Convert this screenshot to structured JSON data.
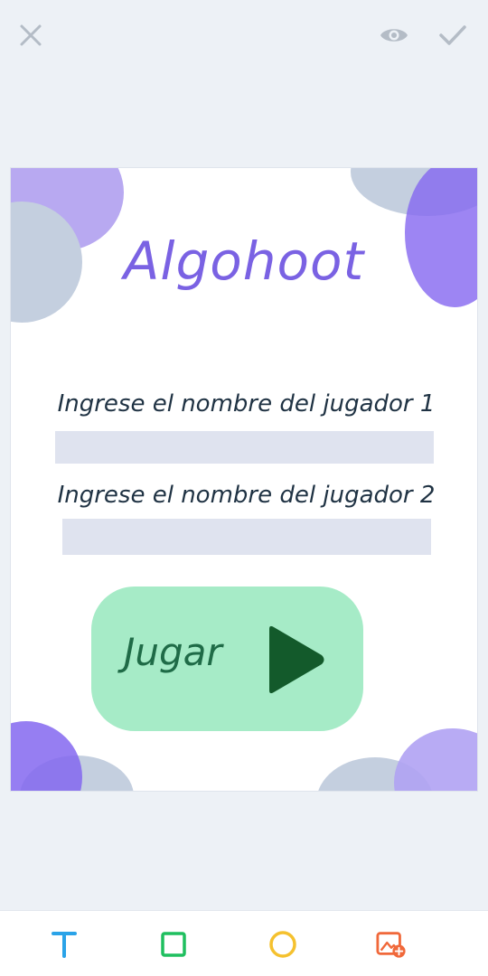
{
  "toolbar_top": {
    "close_icon": "close-icon",
    "preview_icon": "eye-icon",
    "confirm_icon": "check-icon"
  },
  "design": {
    "title": "Algohoot",
    "player1_prompt": "Ingrese el nombre del jugador 1",
    "player1_value": "",
    "player2_prompt": "Ingrese el nombre del jugador 2",
    "player2_value": "",
    "play_label": "Jugar",
    "colors": {
      "title": "#7a62e3",
      "button": "#a6ebc7",
      "button_text": "#1f6b47",
      "play_icon": "#135a2b",
      "input_bg": "#dfe3ef"
    }
  },
  "toolbar_bottom": {
    "tools": [
      "text-tool-icon",
      "rectangle-tool-icon",
      "circle-tool-icon",
      "add-image-tool-icon"
    ],
    "colors": {
      "text": "#2aa3e8",
      "rectangle": "#1fbf5f",
      "circle": "#f5c12e",
      "image": "#f0683a"
    }
  }
}
